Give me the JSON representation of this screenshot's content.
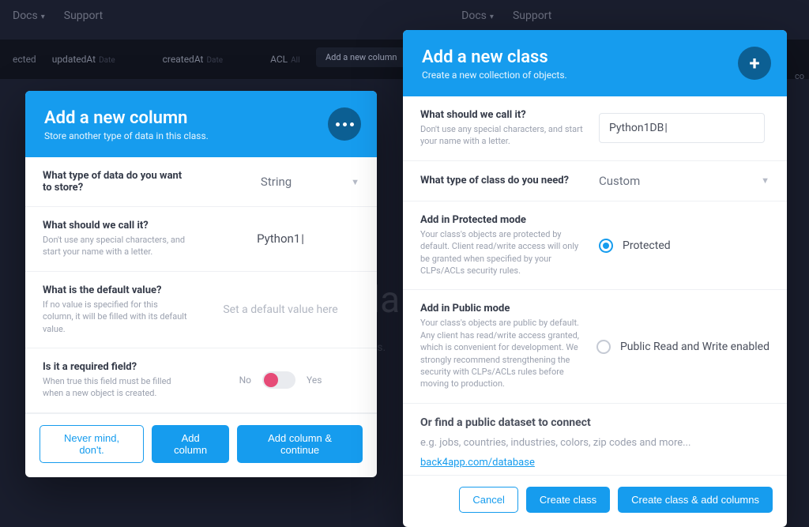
{
  "colors": {
    "primary": "#169cee",
    "primary_dark": "#0c5f93",
    "danger": "#e64b77"
  },
  "background": {
    "topbar": {
      "docs": "Docs",
      "support": "Support"
    },
    "subbar": {
      "filter": "ected",
      "col_updated": "updatedAt",
      "col_created": "createdAt",
      "col_acl": "ACL",
      "add_column": "Add a new column",
      "col_right": "co"
    },
    "faded_heading": "la",
    "faded_sub": "ss."
  },
  "modal_column": {
    "title": "Add a new column",
    "subtitle": "Store another type of data in this class.",
    "rows": {
      "type": {
        "q": "What type of data do you want to store?",
        "value": "String"
      },
      "name": {
        "q": "What should we call it?",
        "hint": "Don't use any special characters, and start your name with a letter.",
        "value": "Python1"
      },
      "default": {
        "q": "What is the default value?",
        "hint": "If no value is specified for this column, it will be filled with its default value.",
        "placeholder": "Set a default value here"
      },
      "required": {
        "q": "Is it a required field?",
        "hint": "When true this field must be filled when a new object is created.",
        "no": "No",
        "yes": "Yes"
      }
    },
    "buttons": {
      "cancel": "Never mind, don't.",
      "primary": "Add column",
      "primary2": "Add column & continue"
    }
  },
  "modal_class": {
    "title": "Add a new class",
    "subtitle": "Create a new collection of objects.",
    "rows": {
      "name": {
        "q": "What should we call it?",
        "hint": "Don't use any special characters, and start your name with a letter.",
        "value": "Python1DB"
      },
      "type": {
        "q": "What type of class do you need?",
        "value": "Custom"
      },
      "protected": {
        "q": "Add in Protected mode",
        "hint": "Your class's objects are protected by default. Client read/write access will only be granted when specified by your CLPs/ACLs security rules.",
        "label": "Protected"
      },
      "public": {
        "q": "Add in Public mode",
        "hint": "Your class's objects are public by default. Any client has read/write access granted, which is convenient for development. We strongly recommend strengthening the security with CLPs/ACLs rules before moving to production.",
        "label": "Public Read and Write enabled"
      }
    },
    "public_ds": {
      "heading": "Or find a public dataset to connect",
      "example": "e.g. jobs, countries, industries, colors, zip codes and more...",
      "link": "back4app.com/database"
    },
    "buttons": {
      "cancel": "Cancel",
      "primary": "Create class",
      "primary2": "Create class & add columns"
    }
  }
}
